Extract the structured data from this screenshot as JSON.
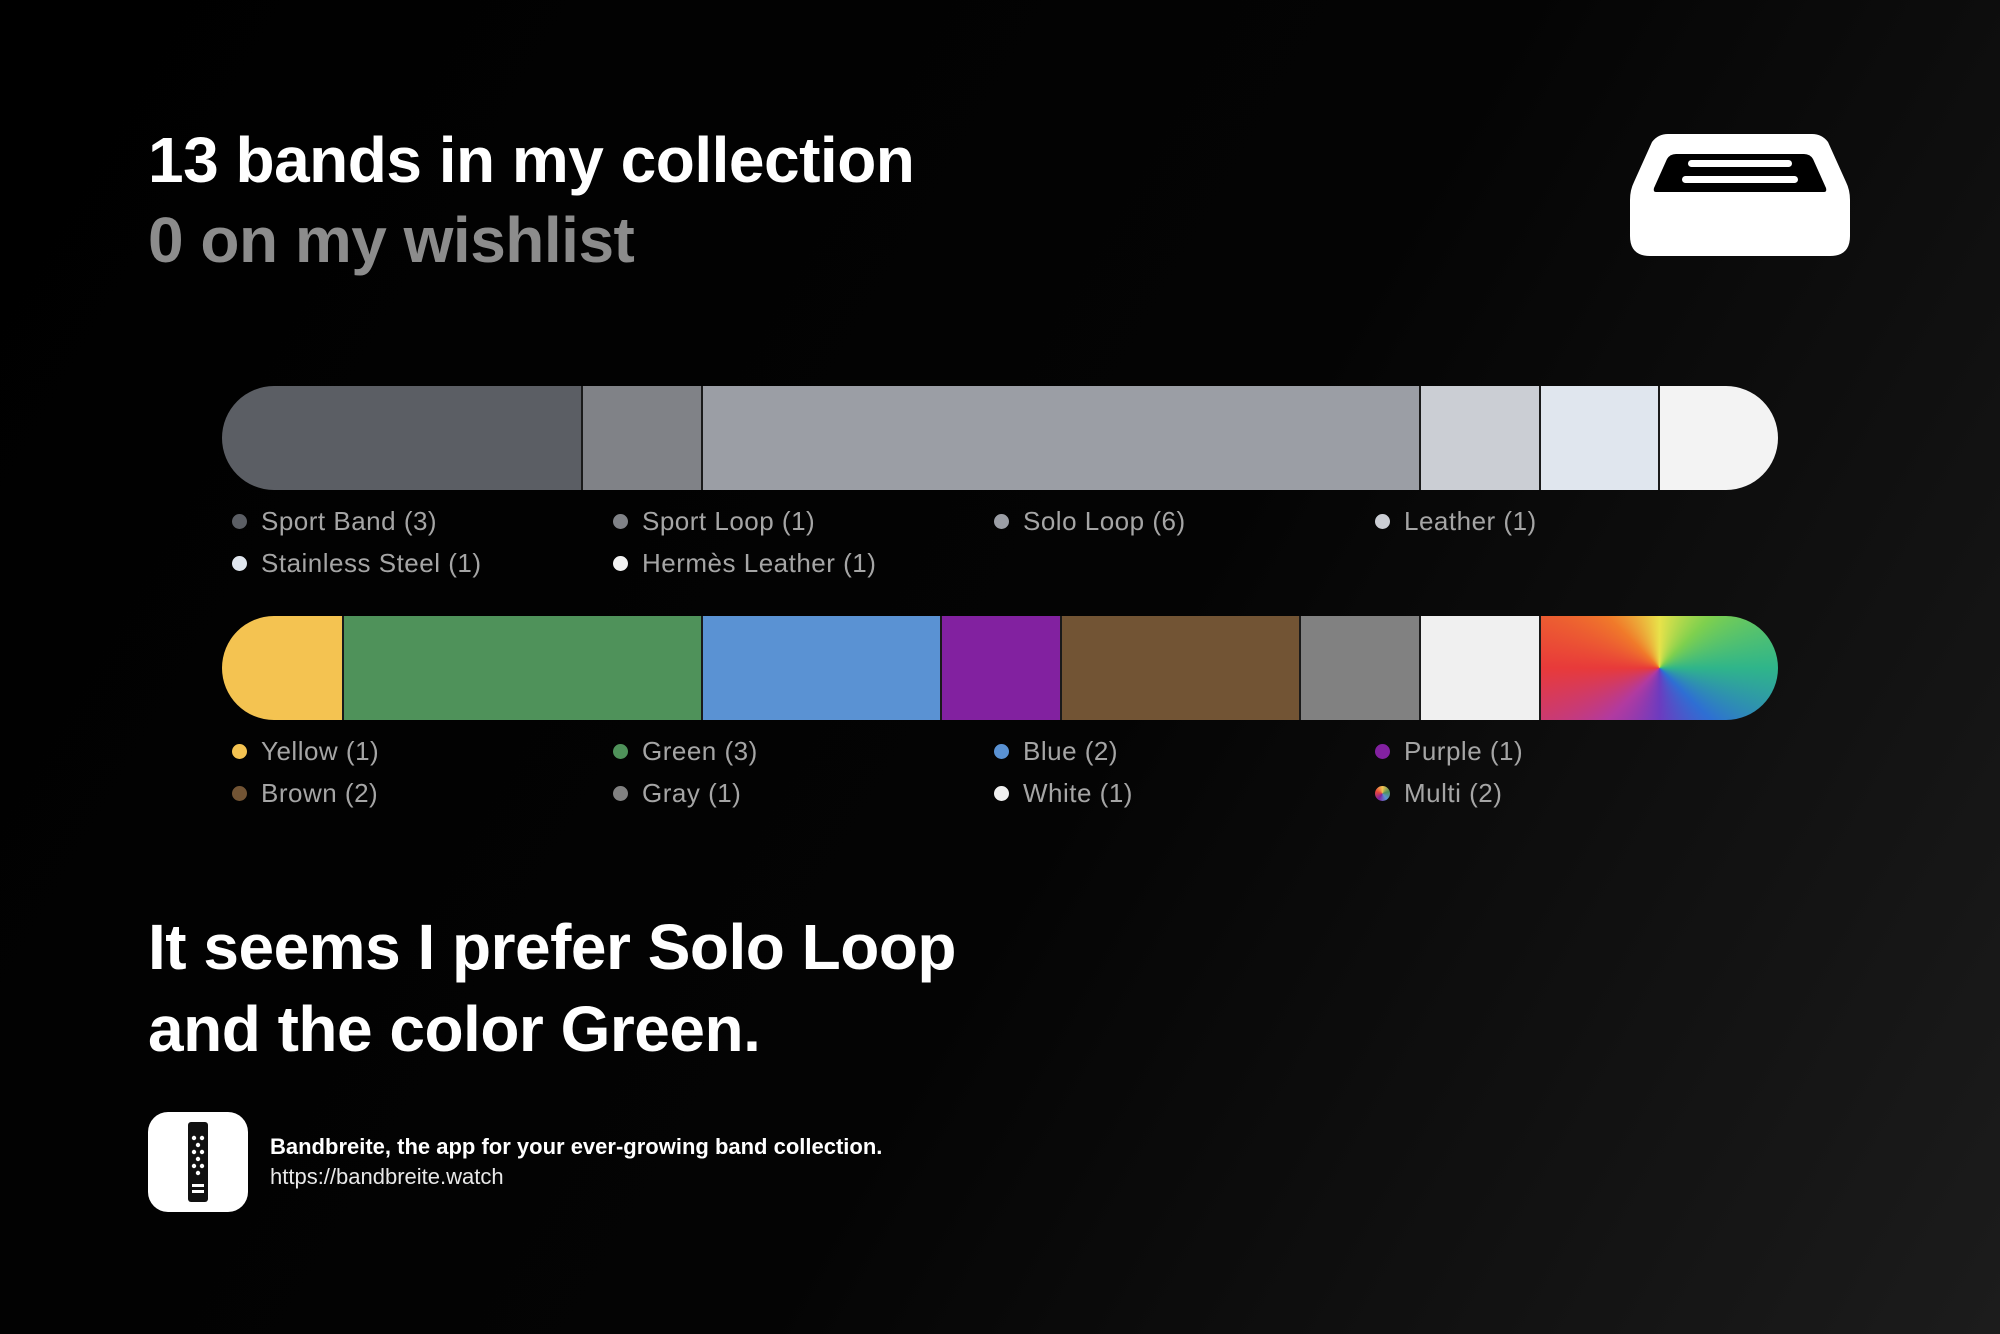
{
  "header": {
    "title": "13 bands in my collection",
    "subtitle": "0 on my wishlist"
  },
  "icons": {
    "tray": "tray-icon",
    "app": "watch-band-icon"
  },
  "chart_data": [
    {
      "type": "bar",
      "orientation": "horizontal-stacked",
      "categories": [
        "Sport Band",
        "Sport Loop",
        "Solo Loop",
        "Leather",
        "Stainless Steel",
        "Hermès Leather"
      ],
      "values": [
        3,
        1,
        6,
        1,
        1,
        1
      ],
      "colors": [
        "#5b5e64",
        "#808287",
        "#9b9ea5",
        "#cbced4",
        "#e0e6ee",
        "#f3f3f3"
      ],
      "legend_labels": [
        "Sport Band (3)",
        "Sport Loop (1)",
        "Solo Loop (6)",
        "Leather (1)",
        "Stainless Steel (1)",
        "Hermès Leather (1)"
      ],
      "legend_position": "below"
    },
    {
      "type": "bar",
      "orientation": "horizontal-stacked",
      "categories": [
        "Yellow",
        "Green",
        "Blue",
        "Purple",
        "Brown",
        "Gray",
        "White",
        "Multi"
      ],
      "values": [
        1,
        3,
        2,
        1,
        2,
        1,
        1,
        2
      ],
      "colors": [
        "#f4c351",
        "#4f925a",
        "#5a92d3",
        "#8221a0",
        "#725434",
        "#818181",
        "#f0f0f0",
        "multicolor"
      ],
      "legend_labels": [
        "Yellow (1)",
        "Green (3)",
        "Blue (2)",
        "Purple (1)",
        "Brown (2)",
        "Gray (1)",
        "White (1)",
        "Multi (2)"
      ],
      "legend_position": "below"
    }
  ],
  "conclusion": {
    "line1": "It seems I prefer Solo Loop",
    "line2": "and the color Green."
  },
  "footer": {
    "tagline": "Bandbreite, the app for your ever-growing band collection.",
    "url": "https://bandbreite.watch"
  }
}
